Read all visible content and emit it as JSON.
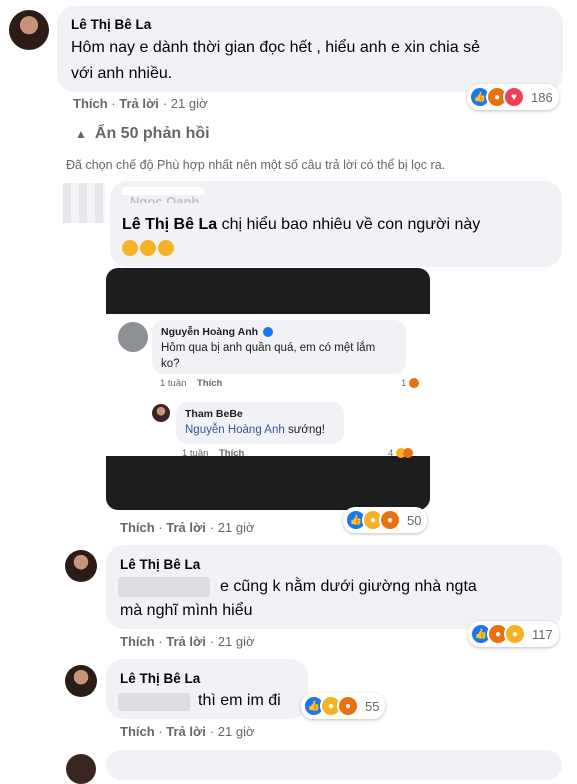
{
  "comment1": {
    "author": "Lê Thị Bê La",
    "text_line1": "Hôm nay e dành thời gian đọc hết , hiểu anh e xin chia sẻ",
    "text_line2": "với anh nhiều.",
    "like": "Thích",
    "reply": "Trả lời",
    "time": "· 21 giờ",
    "reaction_count": "186"
  },
  "hide_replies": "Ẩn 50 phản hồi",
  "filter_note": "Đã chọn chế độ Phù hợp nhất nên một số câu trả lời có thể bị lọc ra.",
  "reply1": {
    "author_partial": "Ngọc Oanh",
    "tag": "Lê Thị Bê La",
    "text": "chị hiểu bao nhiêu về con người này",
    "like": "Thích",
    "reply": "Trả lời",
    "time": "· 21 giờ",
    "reaction_count": "50"
  },
  "screenshot": {
    "c1_name": "Nguyễn Hoàng Anh",
    "c1_line1": "Hôm qua bị anh quần quá, em có mệt lắm",
    "c1_line2": "ko?",
    "c1_time": "1 tuần",
    "c1_like": "Thích",
    "c1_count": "1",
    "c2_name": "Tham BeBe",
    "c2_tag": "Nguyễn Hoàng Anh",
    "c2_text": "sướng!",
    "c2_time": "1 tuần",
    "c2_like": "Thích",
    "c2_count": "4"
  },
  "reply2": {
    "author": "Lê Thị Bê La",
    "text_line1": "e cũng k nằm dưới giường nhà ngta",
    "text_line2": "mà nghĩ mình hiểu",
    "like": "Thích",
    "reply": "Trả lời",
    "time": "· 21 giờ",
    "reaction_count": "117"
  },
  "reply3": {
    "author": "Lê Thị Bê La",
    "text": "thì em im đi",
    "like": "Thích",
    "reply": "Trả lời",
    "time": "· 21 giờ",
    "reaction_count": "55"
  },
  "colors": {
    "like": "#1877f2",
    "angry": "#e9710f",
    "love": "#f33e58",
    "haha": "#f7b125",
    "bubble": "#f0f2f5"
  }
}
